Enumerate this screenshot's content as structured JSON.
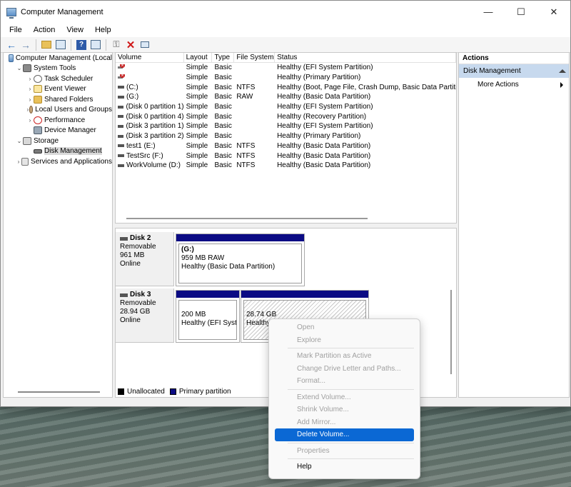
{
  "window": {
    "title": "Computer Management",
    "controls": {
      "minimize": "—",
      "maximize": "☐",
      "close": "✕"
    }
  },
  "menubar": [
    "File",
    "Action",
    "View",
    "Help"
  ],
  "toolbar": {
    "back": "←",
    "forward": "→",
    "help": "?",
    "delete": "✕"
  },
  "tree": {
    "items": [
      {
        "label": "Computer Management (Local",
        "level": 0,
        "twisty": "",
        "icon": "comp"
      },
      {
        "label": "System Tools",
        "level": 1,
        "twisty": "⌄",
        "icon": "tools"
      },
      {
        "label": "Task Scheduler",
        "level": 2,
        "twisty": "›",
        "icon": "clock"
      },
      {
        "label": "Event Viewer",
        "level": 2,
        "twisty": "›",
        "icon": "log"
      },
      {
        "label": "Shared Folders",
        "level": 2,
        "twisty": "›",
        "icon": "folder"
      },
      {
        "label": "Local Users and Groups",
        "level": 2,
        "twisty": "›",
        "icon": "users"
      },
      {
        "label": "Performance",
        "level": 2,
        "twisty": "›",
        "icon": "perf"
      },
      {
        "label": "Device Manager",
        "level": 2,
        "twisty": "",
        "icon": "dev"
      },
      {
        "label": "Storage",
        "level": 1,
        "twisty": "⌄",
        "icon": "storage"
      },
      {
        "label": "Disk Management",
        "level": 2,
        "twisty": "",
        "icon": "disk",
        "selected": true
      },
      {
        "label": "Services and Applications",
        "level": 1,
        "twisty": "›",
        "icon": "svc"
      }
    ]
  },
  "volumes": {
    "headers": [
      "Volume",
      "Layout",
      "Type",
      "File System",
      "Status"
    ],
    "rows": [
      {
        "volume": "",
        "layout": "Simple",
        "type": "Basic",
        "fs": "",
        "status": "Healthy (EFI System Partition)",
        "err": true
      },
      {
        "volume": "",
        "layout": "Simple",
        "type": "Basic",
        "fs": "",
        "status": "Healthy (Primary Partition)",
        "err": true
      },
      {
        "volume": "(C:)",
        "layout": "Simple",
        "type": "Basic",
        "fs": "NTFS",
        "status": "Healthy (Boot, Page File, Crash Dump, Basic Data Partition)"
      },
      {
        "volume": "(G:)",
        "layout": "Simple",
        "type": "Basic",
        "fs": "RAW",
        "status": "Healthy (Basic Data Partition)"
      },
      {
        "volume": "(Disk 0 partition 1)",
        "layout": "Simple",
        "type": "Basic",
        "fs": "",
        "status": "Healthy (EFI System Partition)"
      },
      {
        "volume": "(Disk 0 partition 4)",
        "layout": "Simple",
        "type": "Basic",
        "fs": "",
        "status": "Healthy (Recovery Partition)"
      },
      {
        "volume": "(Disk 3 partition 1)",
        "layout": "Simple",
        "type": "Basic",
        "fs": "",
        "status": "Healthy (EFI System Partition)"
      },
      {
        "volume": "(Disk 3 partition 2)",
        "layout": "Simple",
        "type": "Basic",
        "fs": "",
        "status": "Healthy (Primary Partition)"
      },
      {
        "volume": "test1 (E:)",
        "layout": "Simple",
        "type": "Basic",
        "fs": "NTFS",
        "status": "Healthy (Basic Data Partition)"
      },
      {
        "volume": "TestSrc (F:)",
        "layout": "Simple",
        "type": "Basic",
        "fs": "NTFS",
        "status": "Healthy (Basic Data Partition)"
      },
      {
        "volume": "WorkVolume (D:)",
        "layout": "Simple",
        "type": "Basic",
        "fs": "NTFS",
        "status": "Healthy (Basic Data Partition)"
      }
    ]
  },
  "disks": {
    "disk2": {
      "name": "Disk 2",
      "kind": "Removable",
      "size": "961 MB",
      "state": "Online",
      "partition": {
        "title": "(G:)",
        "size": "959 MB RAW",
        "status": "Healthy (Basic Data Partition)"
      }
    },
    "disk3": {
      "name": "Disk 3",
      "kind": "Removable",
      "size": "28.94 GB",
      "state": "Online",
      "partition1": {
        "size": "200 MB",
        "status": "Healthy (EFI Syster"
      },
      "partition2": {
        "size": "28.74 GB",
        "status": "Healthy"
      }
    }
  },
  "legend": {
    "unallocated": "Unallocated",
    "primary": "Primary partition",
    "unallocated_color": "#000000",
    "primary_color": "#0b0b84"
  },
  "actions": {
    "title": "Actions",
    "section": "Disk Management",
    "more": "More Actions"
  },
  "context_menu": {
    "items": [
      {
        "label": "Open",
        "enabled": false
      },
      {
        "label": "Explore",
        "enabled": false
      },
      {
        "sep": true
      },
      {
        "label": "Mark Partition as Active",
        "enabled": false
      },
      {
        "label": "Change Drive Letter and Paths...",
        "enabled": false
      },
      {
        "label": "Format...",
        "enabled": false
      },
      {
        "sep": true
      },
      {
        "label": "Extend Volume...",
        "enabled": false
      },
      {
        "label": "Shrink Volume...",
        "enabled": false
      },
      {
        "label": "Add Mirror...",
        "enabled": false
      },
      {
        "label": "Delete Volume...",
        "enabled": true,
        "highlight": true
      },
      {
        "sep": true
      },
      {
        "label": "Properties",
        "enabled": false
      },
      {
        "sep": true
      },
      {
        "label": "Help",
        "enabled": true
      }
    ]
  },
  "colors": {
    "accent": "#0b68d4",
    "partition_band": "#0b0b84",
    "actions_section": "#c7d9ee"
  }
}
